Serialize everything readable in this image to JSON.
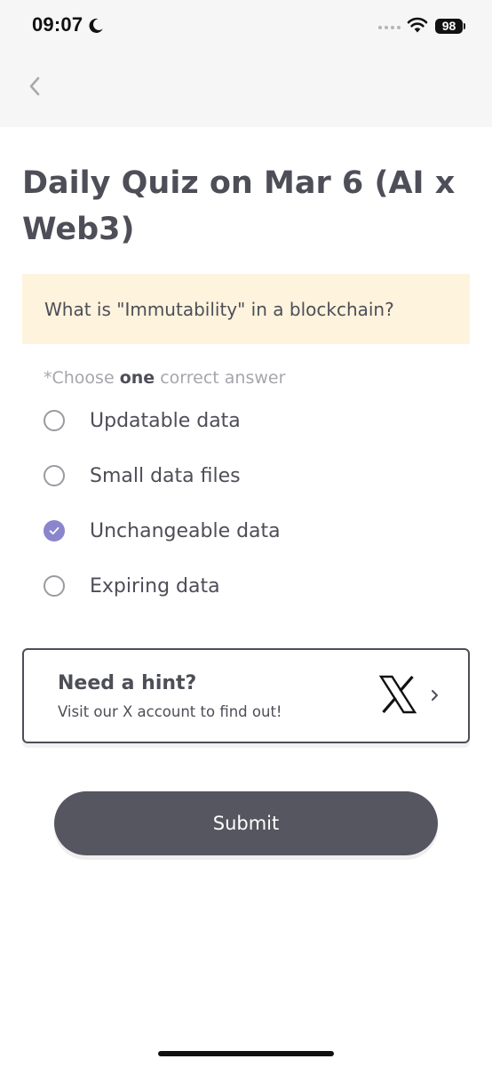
{
  "status_bar": {
    "time": "09:07",
    "battery": "98"
  },
  "page": {
    "title": "Daily Quiz on Mar 6 (AI x Web3)"
  },
  "question": {
    "text": "What is \"Immutability\" in a blockchain?"
  },
  "instruction": {
    "prefix": "*Choose ",
    "emphasis": "one",
    "suffix": " correct answer"
  },
  "options": [
    {
      "label": "Updatable data",
      "selected": false
    },
    {
      "label": "Small data files",
      "selected": false
    },
    {
      "label": "Unchangeable data",
      "selected": true
    },
    {
      "label": "Expiring data",
      "selected": false
    }
  ],
  "hint": {
    "title": "Need a hint?",
    "subtitle": "Visit our X account to find out!",
    "icon": "x-logo-icon"
  },
  "actions": {
    "submit_label": "Submit"
  },
  "colors": {
    "accent": "#8a85cc",
    "question_bg": "#fef3dd",
    "submit_bg": "#555660",
    "text": "#4d4e57"
  }
}
